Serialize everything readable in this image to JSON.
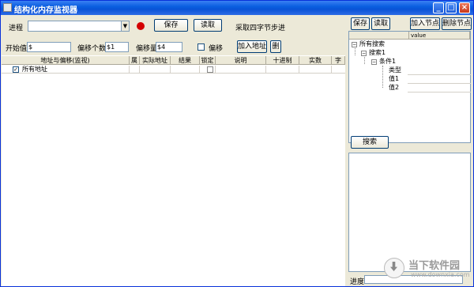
{
  "window": {
    "title": "结构化内存监视器",
    "controls": [
      "_",
      "□",
      "×"
    ]
  },
  "toolbar": {
    "process_label": "进程",
    "process_value": "",
    "save_label": "保存",
    "read_label": "读取",
    "read4_label": "采取四字节步进",
    "start_label": "开始值",
    "start_value": "$",
    "offset_count_label": "偏移个数",
    "offset_count_value": "$1",
    "offset_amount_label": "偏移量",
    "offset_amount_value": "$4",
    "offset_check_label": "偏移",
    "add_address_label": "加入地址",
    "delete_label": "删"
  },
  "grid": {
    "columns": [
      "地址与偏移(监视)",
      "属",
      "实际地址",
      "结果",
      "锁定",
      "说明",
      "十进制",
      "实数",
      "字"
    ],
    "rows": [
      {
        "checked": true,
        "address": "所有地址",
        "locked": false
      }
    ]
  },
  "right": {
    "save_label": "保存",
    "read_label": "读取",
    "add_node_label": "加入节点",
    "delete_node_label": "删除节点",
    "tree_header_value": "value",
    "tree": {
      "root": "所有搜索",
      "search": "搜索1",
      "condition": "条件1",
      "leaves": [
        "类型",
        "值1",
        "值2"
      ]
    },
    "search_button_label": "搜索",
    "progress_label": "进度"
  },
  "watermark": {
    "brand": "当下软件园",
    "url": "www.downxia.com"
  }
}
